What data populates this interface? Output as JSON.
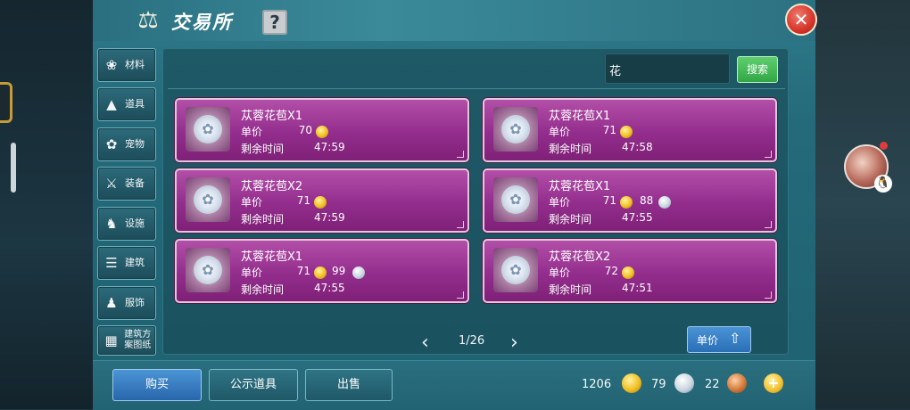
{
  "window": {
    "title": "交易所",
    "help_label": "?",
    "close_label": "✕"
  },
  "sidebar": {
    "items": [
      {
        "label": "材料",
        "icon": "materials-icon",
        "glyph": "❀"
      },
      {
        "label": "道具",
        "icon": "props-icon",
        "glyph": "▲"
      },
      {
        "label": "宠物",
        "icon": "paw-icon",
        "glyph": "✿"
      },
      {
        "label": "装备",
        "icon": "equipment-icon",
        "glyph": "⚔"
      },
      {
        "label": "设施",
        "icon": "facility-icon",
        "glyph": "♞"
      },
      {
        "label": "建筑",
        "icon": "building-icon",
        "glyph": "☰"
      },
      {
        "label": "服饰",
        "icon": "clothing-icon",
        "glyph": "♟"
      },
      {
        "label": "建筑方案图纸",
        "icon": "blueprint-icon",
        "glyph": "▦"
      }
    ]
  },
  "search": {
    "value": "花",
    "button_label": "搜索"
  },
  "listings": [
    {
      "name": "苁蓉花苞X1",
      "price_label": "单价",
      "gold": "70",
      "silver": "",
      "time_label": "剩余时间",
      "time": "47:59"
    },
    {
      "name": "苁蓉花苞X1",
      "price_label": "单价",
      "gold": "71",
      "silver": "",
      "time_label": "剩余时间",
      "time": "47:58"
    },
    {
      "name": "苁蓉花苞X2",
      "price_label": "单价",
      "gold": "71",
      "silver": "",
      "time_label": "剩余时间",
      "time": "47:59"
    },
    {
      "name": "苁蓉花苞X1",
      "price_label": "单价",
      "gold": "71",
      "silver": "88",
      "time_label": "剩余时间",
      "time": "47:55"
    },
    {
      "name": "苁蓉花苞X1",
      "price_label": "单价",
      "gold": "71",
      "silver": "99",
      "time_label": "剩余时间",
      "time": "47:55"
    },
    {
      "name": "苁蓉花苞X2",
      "price_label": "单价",
      "gold": "72",
      "silver": "",
      "time_label": "剩余时间",
      "time": "47:51"
    }
  ],
  "pager": {
    "text": "1/26",
    "prev": "‹",
    "next": "›"
  },
  "sort": {
    "label": "单价",
    "arrow": "⇧"
  },
  "tabs": {
    "buy": "购买",
    "public": "公示道具",
    "sell": "出售"
  },
  "currency": {
    "gold": "1206",
    "silver": "79",
    "copper": "22",
    "plus": "+"
  },
  "colors": {
    "card": "#9a3293",
    "accent_blue": "#2f74b8",
    "search_green": "#3fb552"
  }
}
